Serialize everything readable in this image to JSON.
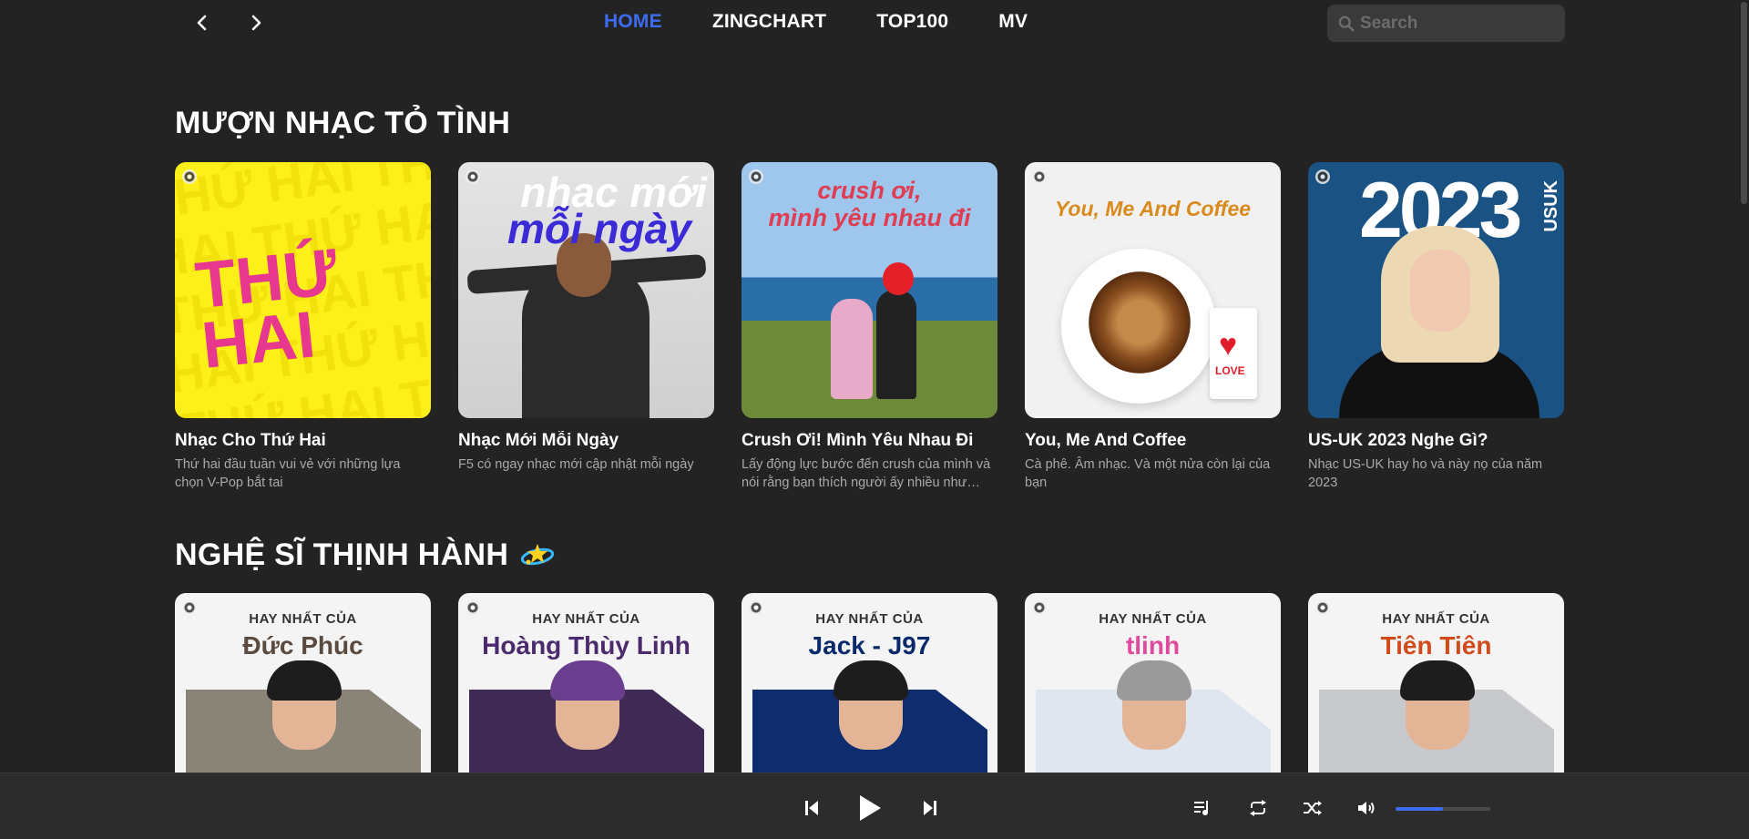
{
  "nav": {
    "menu": [
      {
        "label": "HOME",
        "active": true
      },
      {
        "label": "ZINGCHART",
        "active": false
      },
      {
        "label": "TOP100",
        "active": false
      },
      {
        "label": "MV",
        "active": false
      }
    ],
    "search_placeholder": "Search"
  },
  "sections": [
    {
      "title": "MƯỢN NHẠC TỎ TÌNH",
      "cards": [
        {
          "title": "Nhạc Cho Thứ Hai",
          "desc": "Thứ hai đầu tuần vui vẻ với những lựa chọn V-Pop bắt tai",
          "art_text": "THỨ HAI"
        },
        {
          "title": "Nhạc Mới Mỗi Ngày",
          "desc": "F5 có ngay nhạc mới cập nhật mỗi ngày",
          "art_line1": "nhac mới",
          "art_line2": "mỗi ngày"
        },
        {
          "title": "Crush Ơi! Mình Yêu Nhau Đi",
          "desc": "Lấy động lực bước đến crush của mình và nói rằng bạn thích người ấy nhiều như thế...",
          "art_line1": "crush ơi,",
          "art_line2": "mình yêu nhau đi"
        },
        {
          "title": "You, Me And Coffee",
          "desc": "Cà phê. Âm nhạc. Và một nửa còn lại của bạn",
          "art_text": "You, Me And Coffee",
          "tag_text": "LOVE"
        },
        {
          "title": "US-UK 2023 Nghe Gì?",
          "desc": "Nhạc US-UK hay ho và này nọ của năm 2023",
          "art_year": "2023",
          "art_side": "USUK"
        }
      ]
    },
    {
      "title": "NGHỆ SĨ THỊNH HÀNH",
      "title_icon": "orbit-star-icon",
      "artists": [
        {
          "label": "HAY NHẤT CỦA",
          "name": "Đức Phúc",
          "name_color": "#5b4a3f",
          "bg_color": "#8a8478"
        },
        {
          "label": "HAY NHẤT CỦA",
          "name": "Hoàng Thùy Linh",
          "name_color": "#4b2a6e",
          "bg_color": "#3f2a55"
        },
        {
          "label": "HAY NHẤT CỦA",
          "name": "Jack - J97",
          "name_color": "#0b2a6b",
          "bg_color": "#0e2c6e"
        },
        {
          "label": "HAY NHẤT CỦA",
          "name": "tlinh",
          "name_color": "#e04ba0",
          "bg_color": "#dfe6ef"
        },
        {
          "label": "HAY NHẤT CỦA",
          "name": "Tiên Tiên",
          "name_color": "#d24a1c",
          "bg_color": "#c7c9cc"
        }
      ]
    }
  ],
  "player": {
    "volume": 0.5,
    "accent": "#3d6cf0"
  },
  "colors": {
    "background": "#232323",
    "accent": "#3d6cf0",
    "muted_text": "#a9a9a9"
  }
}
